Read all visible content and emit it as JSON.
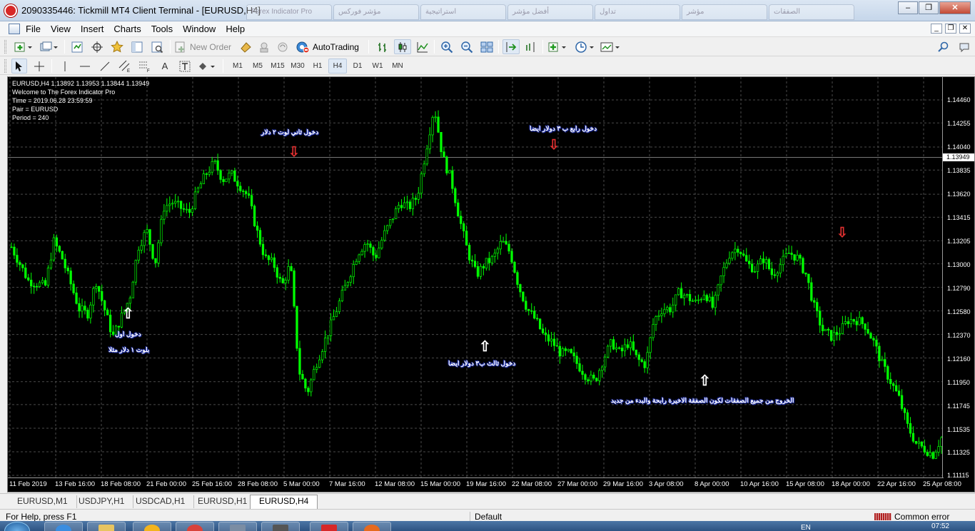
{
  "window": {
    "title": "2090335446: Tickmill MT4 Client Terminal - [EURUSD,H4]",
    "background_tabs": [
      "Forex Indicator Pro",
      "مؤشر فوركس",
      "استراتيجية",
      "أفضل مؤشر",
      "تداول",
      "مؤشر",
      "الصفقات"
    ]
  },
  "menu": [
    "File",
    "View",
    "Insert",
    "Charts",
    "Tools",
    "Window",
    "Help"
  ],
  "toolbar": {
    "new_order_label": "New Order",
    "autotrading_label": "AutoTrading",
    "timeframes": [
      "M1",
      "M5",
      "M15",
      "M30",
      "H1",
      "H4",
      "D1",
      "W1",
      "MN"
    ],
    "active_timeframe": "H4"
  },
  "chart": {
    "header": "EURUSD,H4  1.13892 1.13953 1.13844 1.13949",
    "indicator_lines": [
      "Welcome to The Forex Indicator Pro",
      "Time = 2019.06.28 23:59:59",
      "Pair = EURUSD",
      "Period = 240"
    ],
    "current_price": "1.13949",
    "annotations": {
      "entry1_line1": "دخول اول",
      "entry1_line2": "بلوت ١ دلار مثلا",
      "entry2": "دخول ثاني لوت ٢ دلار",
      "entry3": "دخول ثالث ب٣ دولار ايضا",
      "entry4": "دخول رابع ب ٣ دولار ايضا",
      "exit": "الخروج من جميع الصفقات لكون الصفقة الاخيرة رابحة والبدء من جديد"
    },
    "colors": {
      "background": "#000000",
      "candles": "#00ff00",
      "grid": "#4a4a4a",
      "sell_arrow": "#e03030",
      "buy_arrow": "#ffffff",
      "annotation_outline": "#2233aa"
    }
  },
  "chart_data": {
    "type": "candlestick",
    "symbol": "EURUSD",
    "timeframe": "H4",
    "ylim": [
      1.11115,
      1.1446
    ],
    "price_ticks": [
      "1.14460",
      "1.14255",
      "1.14040",
      "1.13835",
      "1.13620",
      "1.13415",
      "1.13205",
      "1.13000",
      "1.12790",
      "1.12580",
      "1.12370",
      "1.12160",
      "1.11950",
      "1.11745",
      "1.11535",
      "1.11325",
      "1.11115"
    ],
    "time_ticks": [
      "11 Feb 2019",
      "13 Feb 16:00",
      "18 Feb 08:00",
      "21 Feb 00:00",
      "25 Feb 16:00",
      "28 Feb 08:00",
      "5 Mar 00:00",
      "7 Mar 16:00",
      "12 Mar 08:00",
      "15 Mar 00:00",
      "19 Mar 16:00",
      "22 Mar 08:00",
      "27 Mar 00:00",
      "29 Mar 16:00",
      "3 Apr 08:00",
      "8 Apr 00:00",
      "10 Apr 16:00",
      "15 Apr 08:00",
      "18 Apr 00:00",
      "22 Apr 16:00",
      "25 Apr 08:00"
    ],
    "price_path": [
      [
        0,
        1.1315
      ],
      [
        2,
        1.1285
      ],
      [
        4,
        1.128
      ],
      [
        5,
        1.132
      ],
      [
        6,
        1.1305
      ],
      [
        8,
        1.126
      ],
      [
        9,
        1.1255
      ],
      [
        10,
        1.1285
      ],
      [
        12,
        1.1235
      ],
      [
        14,
        1.127
      ],
      [
        15,
        1.1315
      ],
      [
        16,
        1.133
      ],
      [
        17,
        1.13
      ],
      [
        18,
        1.135
      ],
      [
        19,
        1.1355
      ],
      [
        21,
        1.1345
      ],
      [
        22,
        1.1365
      ],
      [
        23,
        1.138
      ],
      [
        24,
        1.139
      ],
      [
        25,
        1.1375
      ],
      [
        26,
        1.138
      ],
      [
        27,
        1.137
      ],
      [
        28,
        1.136
      ],
      [
        29,
        1.133
      ],
      [
        30,
        1.1305
      ],
      [
        31,
        1.13
      ],
      [
        32,
        1.128
      ],
      [
        33,
        1.13
      ],
      [
        34,
        1.1205
      ],
      [
        35,
        1.1185
      ],
      [
        36,
        1.121
      ],
      [
        37,
        1.123
      ],
      [
        38,
        1.125
      ],
      [
        39,
        1.127
      ],
      [
        40,
        1.129
      ],
      [
        41,
        1.131
      ],
      [
        42,
        1.132
      ],
      [
        43,
        1.1305
      ],
      [
        44,
        1.1325
      ],
      [
        45,
        1.134
      ],
      [
        46,
        1.1355
      ],
      [
        47,
        1.135
      ],
      [
        48,
        1.136
      ],
      [
        49,
        1.14
      ],
      [
        50,
        1.144
      ],
      [
        51,
        1.1395
      ],
      [
        52,
        1.1375
      ],
      [
        53,
        1.134
      ],
      [
        54,
        1.131
      ],
      [
        55,
        1.129
      ],
      [
        56,
        1.13
      ],
      [
        57,
        1.1305
      ],
      [
        58,
        1.132
      ],
      [
        59,
        1.131
      ],
      [
        60,
        1.128
      ],
      [
        61,
        1.126
      ],
      [
        62,
        1.125
      ],
      [
        63,
        1.1235
      ],
      [
        64,
        1.123
      ],
      [
        65,
        1.122
      ],
      [
        66,
        1.122
      ],
      [
        67,
        1.121
      ],
      [
        68,
        1.12
      ],
      [
        69,
        1.1195
      ],
      [
        70,
        1.1215
      ],
      [
        71,
        1.123
      ],
      [
        72,
        1.122
      ],
      [
        73,
        1.123
      ],
      [
        74,
        1.1215
      ],
      [
        75,
        1.121
      ],
      [
        76,
        1.125
      ],
      [
        77,
        1.126
      ],
      [
        78,
        1.126
      ],
      [
        79,
        1.1275
      ],
      [
        80,
        1.127
      ],
      [
        81,
        1.1265
      ],
      [
        82,
        1.1275
      ],
      [
        83,
        1.126
      ],
      [
        84,
        1.129
      ],
      [
        85,
        1.131
      ],
      [
        86,
        1.1315
      ],
      [
        87,
        1.13
      ],
      [
        88,
        1.1295
      ],
      [
        89,
        1.1305
      ],
      [
        90,
        1.129
      ],
      [
        91,
        1.13
      ],
      [
        92,
        1.131
      ],
      [
        93,
        1.1305
      ],
      [
        94,
        1.129
      ],
      [
        95,
        1.126
      ],
      [
        96,
        1.124
      ],
      [
        97,
        1.1235
      ],
      [
        98,
        1.124
      ],
      [
        99,
        1.125
      ],
      [
        100,
        1.125
      ],
      [
        101,
        1.1245
      ],
      [
        102,
        1.123
      ],
      [
        103,
        1.121
      ],
      [
        104,
        1.1195
      ],
      [
        105,
        1.118
      ],
      [
        106,
        1.1155
      ],
      [
        107,
        1.114
      ],
      [
        108,
        1.1135
      ],
      [
        109,
        1.113
      ],
      [
        110,
        1.1145
      ]
    ],
    "sell_arrows": [
      "5 Mar 00:00",
      "22 Mar 08:00",
      "18 Apr 00:00"
    ],
    "buy_arrows": [
      "18 Feb 08:00",
      "19 Mar 16:00",
      "8 Apr 00:00"
    ],
    "grid": true
  },
  "chart_tabs": [
    "EURUSD,M1",
    "USDJPY,H1",
    "USDCAD,H1",
    "EURUSD,H1",
    "EURUSD,H4"
  ],
  "active_chart_tab": "EURUSD,H4",
  "status": {
    "help": "For Help, press F1",
    "profile": "Default",
    "server": "Common error"
  },
  "taskbar": {
    "lang": "EN",
    "clock": "07:52"
  }
}
